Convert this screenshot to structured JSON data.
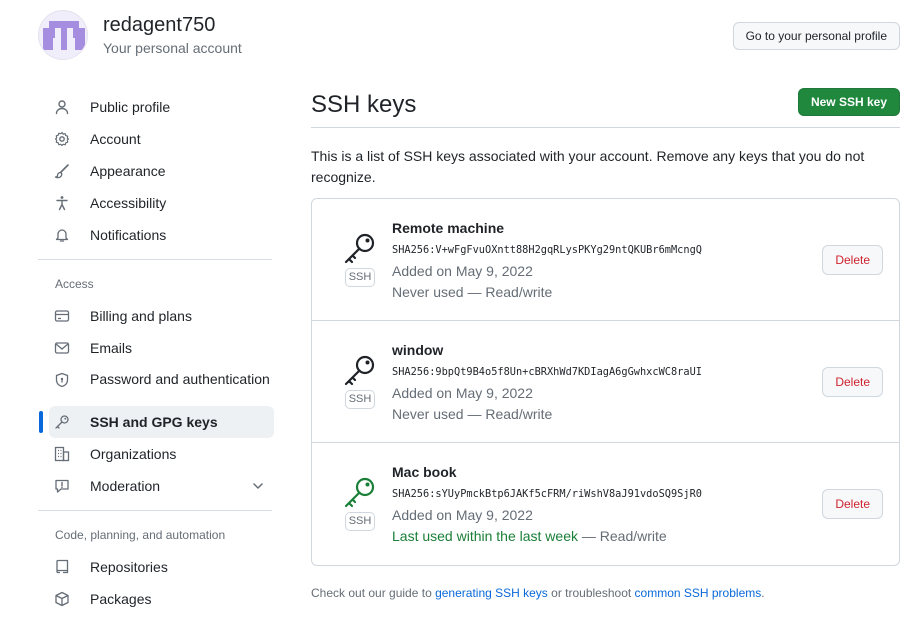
{
  "account": {
    "username": "redagent750",
    "subtitle": "Your personal account",
    "profile_button": "Go to your personal profile"
  },
  "sidebar": {
    "items": [
      {
        "label": "Public profile",
        "icon": "person-icon"
      },
      {
        "label": "Account",
        "icon": "gear-icon"
      },
      {
        "label": "Appearance",
        "icon": "paintbrush-icon"
      },
      {
        "label": "Accessibility",
        "icon": "accessibility-icon"
      },
      {
        "label": "Notifications",
        "icon": "bell-icon"
      }
    ],
    "access_title": "Access",
    "access_items": [
      {
        "label": "Billing and plans",
        "icon": "credit-card-icon"
      },
      {
        "label": "Emails",
        "icon": "mail-icon"
      },
      {
        "label": "Password and authentication",
        "icon": "shield-lock-icon"
      },
      {
        "label": "SSH and GPG keys",
        "icon": "key-icon",
        "active": true
      },
      {
        "label": "Organizations",
        "icon": "organization-icon"
      },
      {
        "label": "Moderation",
        "icon": "report-icon"
      }
    ],
    "code_title": "Code, planning, and automation",
    "code_items": [
      {
        "label": "Repositories",
        "icon": "repo-icon"
      },
      {
        "label": "Packages",
        "icon": "package-icon"
      }
    ]
  },
  "main": {
    "title": "SSH keys",
    "new_button": "New SSH key",
    "description": "This is a list of SSH keys associated with your account. Remove any keys that you do not recognize.",
    "keys": [
      {
        "title": "Remote machine",
        "fingerprint": "SHA256:V+wFgFvuOXntt88H2gqRLysPKYg29ntQKUBr6mMcngQ",
        "added": "Added on May 9, 2022",
        "usage": "Never used",
        "access": " — Read/write",
        "recent": false,
        "badge": "SSH",
        "delete": "Delete"
      },
      {
        "title": "window",
        "fingerprint": "SHA256:9bpQt9B4o5f8Un+cBRXhWd7KDIagA6gGwhxcWC8raUI",
        "added": "Added on May 9, 2022",
        "usage": "Never used",
        "access": " — Read/write",
        "recent": false,
        "badge": "SSH",
        "delete": "Delete"
      },
      {
        "title": "Mac book",
        "fingerprint": "SHA256:sYUyPmckBtp6JAKf5cFRM/riWshV8aJ91vdoSQ9SjR0",
        "added": "Added on May 9, 2022",
        "usage": "Last used within the last week",
        "access": " — Read/write",
        "recent": true,
        "badge": "SSH",
        "delete": "Delete"
      }
    ],
    "footer": {
      "prefix": "Check out our guide to ",
      "link1": "generating SSH keys",
      "middle": " or troubleshoot ",
      "link2": "common SSH problems",
      "suffix": "."
    }
  },
  "colors": {
    "accent": "#0969da",
    "primary_button": "#1f883d",
    "danger": "#cf222e",
    "recent_key": "#1a7f37",
    "avatar": "#a58ee0"
  }
}
